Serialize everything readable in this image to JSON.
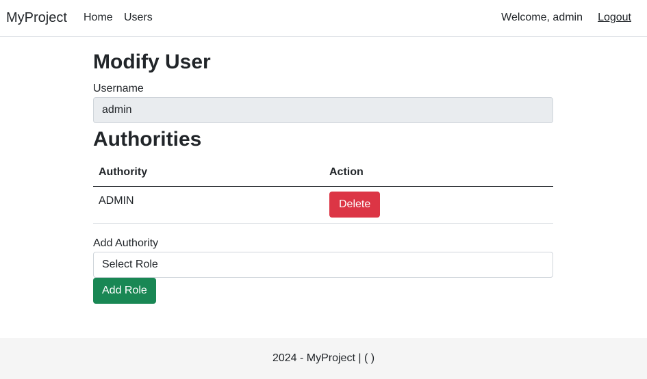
{
  "navbar": {
    "brand": "MyProject",
    "links": [
      {
        "label": "Home"
      },
      {
        "label": "Users"
      }
    ],
    "welcome": "Welcome, admin",
    "logout": "Logout"
  },
  "page": {
    "title": "Modify User",
    "username_label": "Username",
    "username_value": "admin",
    "authorities_title": "Authorities",
    "table": {
      "headers": [
        "Authority",
        "Action"
      ],
      "rows": [
        {
          "authority": "ADMIN",
          "action_label": "Delete"
        }
      ]
    },
    "add_label": "Add Authority",
    "select_value": "Select Role",
    "add_button": "Add Role"
  },
  "footer": {
    "text": "2024 - MyProject | ( )"
  },
  "colors": {
    "delete": "#dc3545",
    "add": "#198754",
    "readonly_bg": "#e9ecef",
    "footer_bg": "#f5f5f5"
  }
}
